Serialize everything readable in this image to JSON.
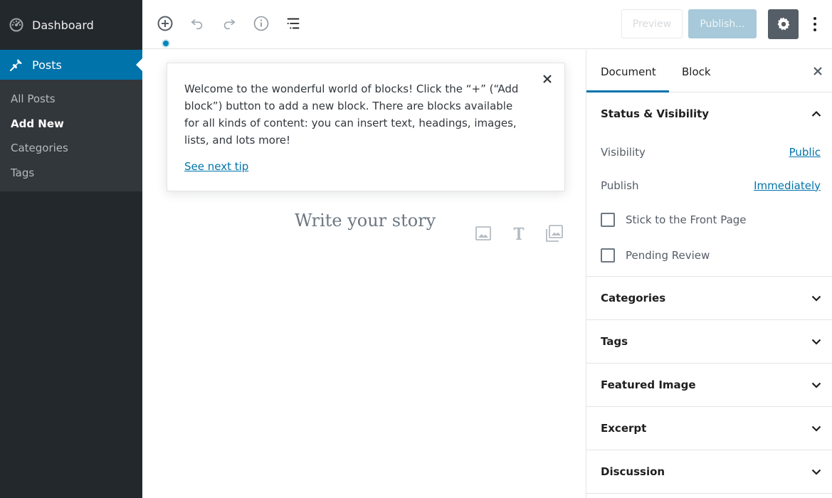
{
  "admin_sidebar": {
    "dashboard_label": "Dashboard",
    "posts_label": "Posts",
    "submenu": [
      "All Posts",
      "Add New",
      "Categories",
      "Tags"
    ]
  },
  "header": {
    "preview_label": "Preview",
    "publish_label": "Publish..."
  },
  "tip": {
    "text": "Welcome to the wonderful world of blocks! Click the “+” (“Add block”) button to add a new block. There are blocks available for all kinds of content: you can insert text, headings, images, lists, and lots more!",
    "link": "See next tip"
  },
  "editor": {
    "placeholder": "Write your story"
  },
  "settings_sidebar": {
    "tabs": [
      "Document",
      "Block"
    ],
    "status_visibility": {
      "title": "Status & Visibility",
      "visibility_label": "Visibility",
      "visibility_value": "Public",
      "publish_label": "Publish",
      "publish_value": "Immediately",
      "stick_label": "Stick to the Front Page",
      "pending_label": "Pending Review"
    },
    "panels": [
      "Categories",
      "Tags",
      "Featured Image",
      "Excerpt",
      "Discussion"
    ]
  },
  "colors": {
    "admin_bg": "#23282d",
    "admin_submenu_bg": "#32373c",
    "accent": "#0073aa",
    "publish_disabled": "#a7c9d9"
  }
}
